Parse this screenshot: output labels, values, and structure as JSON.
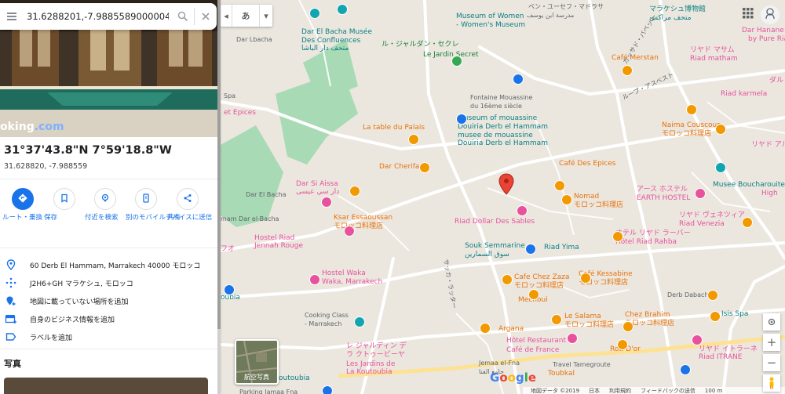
{
  "search": {
    "query": "31.6288201,-7.9885589000004"
  },
  "place": {
    "title": "31°37'43.8\"N 7°59'18.8\"W",
    "decimal": "31.628820, -7.988559",
    "booking_brand": "oking",
    "booking_dot": ".com"
  },
  "actions": [
    {
      "label": "ルート・乗換",
      "icon": "directions-icon"
    },
    {
      "label": "保存",
      "icon": "bookmark-icon"
    },
    {
      "label": "付近を検索",
      "icon": "nearby-icon"
    },
    {
      "label": "別のモバイルデバイスに送信",
      "icon": "send-to-phone-icon"
    },
    {
      "label": "共有",
      "icon": "share-icon"
    }
  ],
  "info": [
    {
      "text": "60 Derb El Hammam, Marrakech 40000 モロッコ",
      "icon": "location-pin-icon"
    },
    {
      "text": "J2H6+GH マラケシュ, モロッコ",
      "icon": "plus-code-icon"
    },
    {
      "text": "地図に載っていない場所を追加",
      "icon": "add-place-icon"
    },
    {
      "text": "自身のビジネス情報を追加",
      "icon": "business-icon"
    },
    {
      "text": "ラベルを追加",
      "icon": "label-icon"
    }
  ],
  "photos_title": "写真",
  "map": {
    "lang_button": "あ",
    "satellite_label": "航空写真",
    "google": "Google",
    "footer": [
      "地図データ ©2019",
      "日本",
      "利用規約",
      "フィードバックの送信",
      "100 m"
    ],
    "labels": [
      {
        "text": "Dar El Bacha Musée",
        "cls": "sight"
      },
      {
        "text": "Des Confluences",
        "cls": "sight"
      },
      {
        "text": "متحف دار الباشا",
        "cls": "sight"
      },
      {
        "text": "Dar Lbacha",
        "cls": "street"
      },
      {
        "text": "Museum of Women",
        "cls": "sight"
      },
      {
        "text": "- Women's Museum",
        "cls": "sight"
      },
      {
        "text": "ベン・ユーセフ・マドラサ",
        "cls": "street"
      },
      {
        "text": "مدرسة ابن يوسف",
        "cls": "street"
      },
      {
        "text": "マラケシュ博物館",
        "cls": "sight"
      },
      {
        "text": "متحف مراكش",
        "cls": "sight"
      },
      {
        "text": "Dar Hanane",
        "cls": "shop"
      },
      {
        "text": "by Pure Riads",
        "cls": "shop"
      },
      {
        "text": "ル・ジャルダン・セクレ",
        "cls": "park"
      },
      {
        "text": "Le Jardin Secret",
        "cls": "park"
      },
      {
        "text": "Café Merstan",
        "cls": "food"
      },
      {
        "text": "リヤド マサム",
        "cls": "shop"
      },
      {
        "text": "Riad matham",
        "cls": "shop"
      },
      {
        "text": "Spa",
        "cls": "street"
      },
      {
        "text": "et Epices",
        "cls": "shop"
      },
      {
        "text": "Fontaine Mouassine",
        "cls": "street"
      },
      {
        "text": "du 16ème siècle",
        "cls": "street"
      },
      {
        "text": "Museum of mouassine",
        "cls": "sight"
      },
      {
        "text": "Douiria Derb el Hammam",
        "cls": "sight"
      },
      {
        "text": "musee de mouassine",
        "cls": "sight"
      },
      {
        "text": "Douiria Derb el Hammam",
        "cls": "sight"
      },
      {
        "text": "Riad karmela",
        "cls": "shop"
      },
      {
        "text": "La table du Palais",
        "cls": "food"
      },
      {
        "text": "Naima Couscous",
        "cls": "food"
      },
      {
        "text": "モロッコ料理店",
        "cls": "food"
      },
      {
        "text": "リヤド アル ルー",
        "cls": "shop"
      },
      {
        "text": "Dar Cherifa",
        "cls": "food"
      },
      {
        "text": "Café Des Epices",
        "cls": "food"
      },
      {
        "text": "Dar Si Aissa",
        "cls": "shop"
      },
      {
        "text": "دار سي عيسى",
        "cls": "shop"
      },
      {
        "text": "Dar El Bacha",
        "cls": "street"
      },
      {
        "text": "Musee Boucharouite",
        "cls": "sight"
      },
      {
        "text": "アース ホステル",
        "cls": "shop"
      },
      {
        "text": "EARTH HOSTEL",
        "cls": "shop"
      },
      {
        "text": "Nomad",
        "cls": "food"
      },
      {
        "text": "モロッコ料理店",
        "cls": "food"
      },
      {
        "text": "mam Dar el-Bacha",
        "cls": "street"
      },
      {
        "text": "Ksar Essaoussan",
        "cls": "food"
      },
      {
        "text": "モロッコ料理店",
        "cls": "food"
      },
      {
        "text": "Riad Dollar Des Sables",
        "cls": "shop"
      },
      {
        "text": "リヤド ヴェネツィア",
        "cls": "shop"
      },
      {
        "text": "Riad Venezia",
        "cls": "shop"
      },
      {
        "text": "Hostel Riad",
        "cls": "shop"
      },
      {
        "text": "Jennah Rouge",
        "cls": "shop"
      },
      {
        "text": "フオ",
        "cls": "shop"
      },
      {
        "text": "オテル リヤド ラーバー",
        "cls": "shop"
      },
      {
        "text": "Hôtel Riad Rahba",
        "cls": "shop"
      },
      {
        "text": "Souk Semmarine",
        "cls": "sight"
      },
      {
        "text": "سوق السمارين",
        "cls": "sight"
      },
      {
        "text": "Riad Yima",
        "cls": "sight"
      },
      {
        "text": "Hostel Waka",
        "cls": "shop"
      },
      {
        "text": "Waka, Marrakech",
        "cls": "shop"
      },
      {
        "text": "Cafe Chez Zaza",
        "cls": "food"
      },
      {
        "text": "モロッコ料理店",
        "cls": "food"
      },
      {
        "text": "Café Kessabine",
        "cls": "food"
      },
      {
        "text": "モロッコ料理店",
        "cls": "food"
      },
      {
        "text": "oubia",
        "cls": "sight"
      },
      {
        "text": "Mechoui",
        "cls": "food"
      },
      {
        "text": "Derb Dabachi",
        "cls": "street"
      },
      {
        "text": "Cooking Class",
        "cls": "street"
      },
      {
        "text": "- Marrakech",
        "cls": "street"
      },
      {
        "text": "Isis Spa",
        "cls": "sight"
      },
      {
        "text": "Le Salama",
        "cls": "food"
      },
      {
        "text": "モロッコ料理店",
        "cls": "food"
      },
      {
        "text": "Chez Brahim",
        "cls": "food"
      },
      {
        "text": "モロッコ料理店",
        "cls": "food"
      },
      {
        "text": "Argana",
        "cls": "food"
      },
      {
        "text": "Hôtel Restaurant",
        "cls": "shop"
      },
      {
        "text": "Café de France",
        "cls": "shop"
      },
      {
        "text": "Roti D'or",
        "cls": "food"
      },
      {
        "text": "レ ジャルディン デ",
        "cls": "shop"
      },
      {
        "text": "ラ クトゥービーヤ",
        "cls": "shop"
      },
      {
        "text": "Les Jardins de",
        "cls": "shop"
      },
      {
        "text": "La Koutoubia",
        "cls": "shop"
      },
      {
        "text": "リヤド イトラーネ",
        "cls": "shop"
      },
      {
        "text": "Riad ITRANE",
        "cls": "shop"
      },
      {
        "text": "Jemaa el-Fna",
        "cls": "street"
      },
      {
        "text": "جامع الفنا",
        "cls": "street"
      },
      {
        "text": "Travel Tamegroute",
        "cls": "street"
      },
      {
        "text": "Toubkal",
        "cls": "food"
      },
      {
        "text": "m of La Koutoubia",
        "cls": "sight"
      },
      {
        "text": "Parking Jamaa Fna",
        "cls": "street"
      },
      {
        "text": "ダル",
        "cls": "shop"
      },
      {
        "text": "High",
        "cls": "shop"
      },
      {
        "text": "カッサド・バベット",
        "cls": "street"
      },
      {
        "text": "ループ・アスベスト",
        "cls": "street"
      },
      {
        "text": "サッカ・ラッター",
        "cls": "street"
      }
    ]
  }
}
